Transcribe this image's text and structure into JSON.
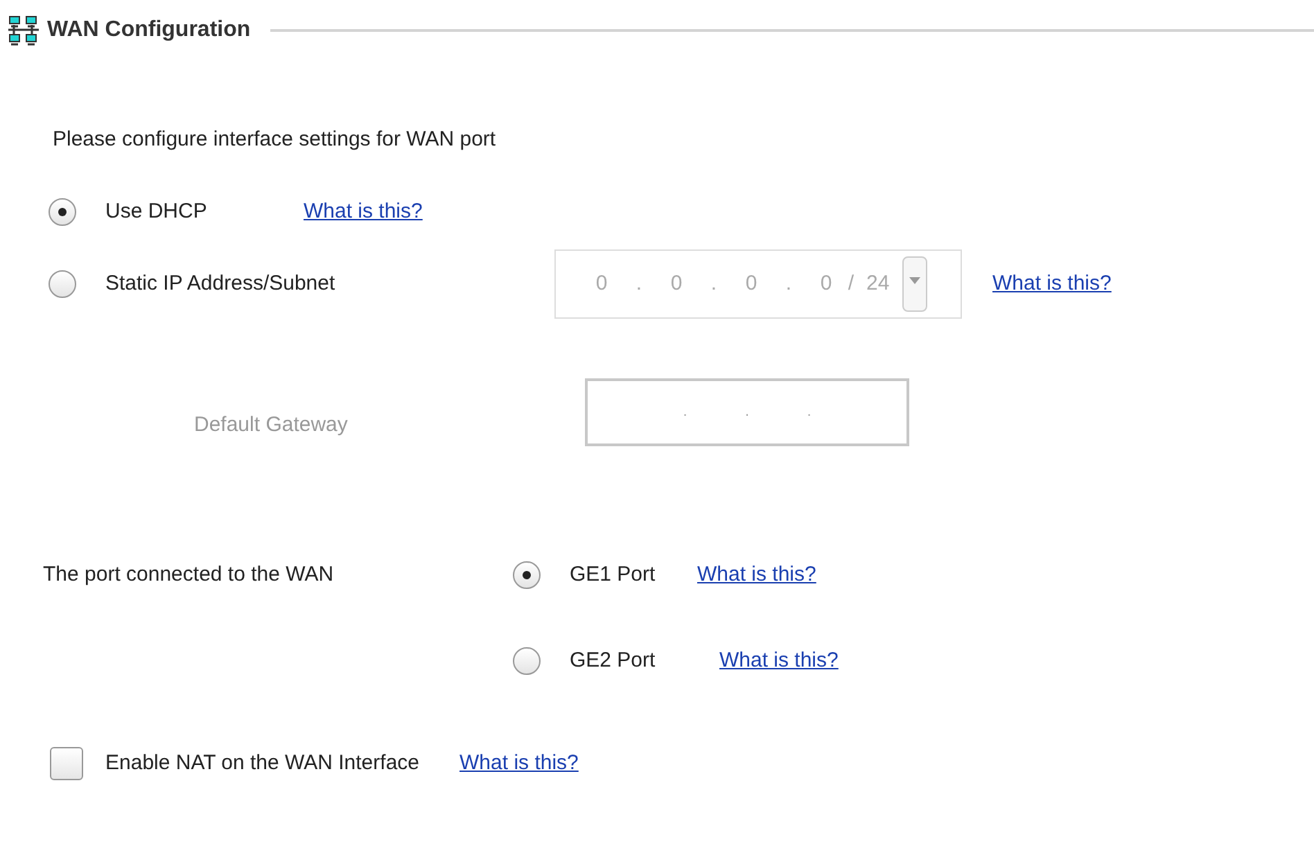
{
  "section": {
    "title": "WAN Configuration"
  },
  "intro": "Please configure interface settings for WAN port",
  "modes": [
    {
      "label": "Use DHCP",
      "selected": true,
      "link": "What is this?"
    },
    {
      "label": "Static IP Address/Subnet",
      "selected": false,
      "link": "What is this?"
    }
  ],
  "static_ip": {
    "disabled": true,
    "octets": [
      "0",
      "0",
      "0",
      "0"
    ],
    "separator": ".",
    "prefix_separator": "/",
    "prefix": "24"
  },
  "gateway": {
    "label": "Default Gateway",
    "disabled": true,
    "separator": "."
  },
  "wan_port": {
    "label": "The port connected to the WAN",
    "options": [
      {
        "label": "GE1 Port",
        "selected": true,
        "link": "What is this?"
      },
      {
        "label": "GE2 Port",
        "selected": false,
        "link": "What is this?"
      }
    ]
  },
  "nat": {
    "label": "Enable NAT on the WAN Interface",
    "checked": false,
    "link": "What is this?"
  }
}
